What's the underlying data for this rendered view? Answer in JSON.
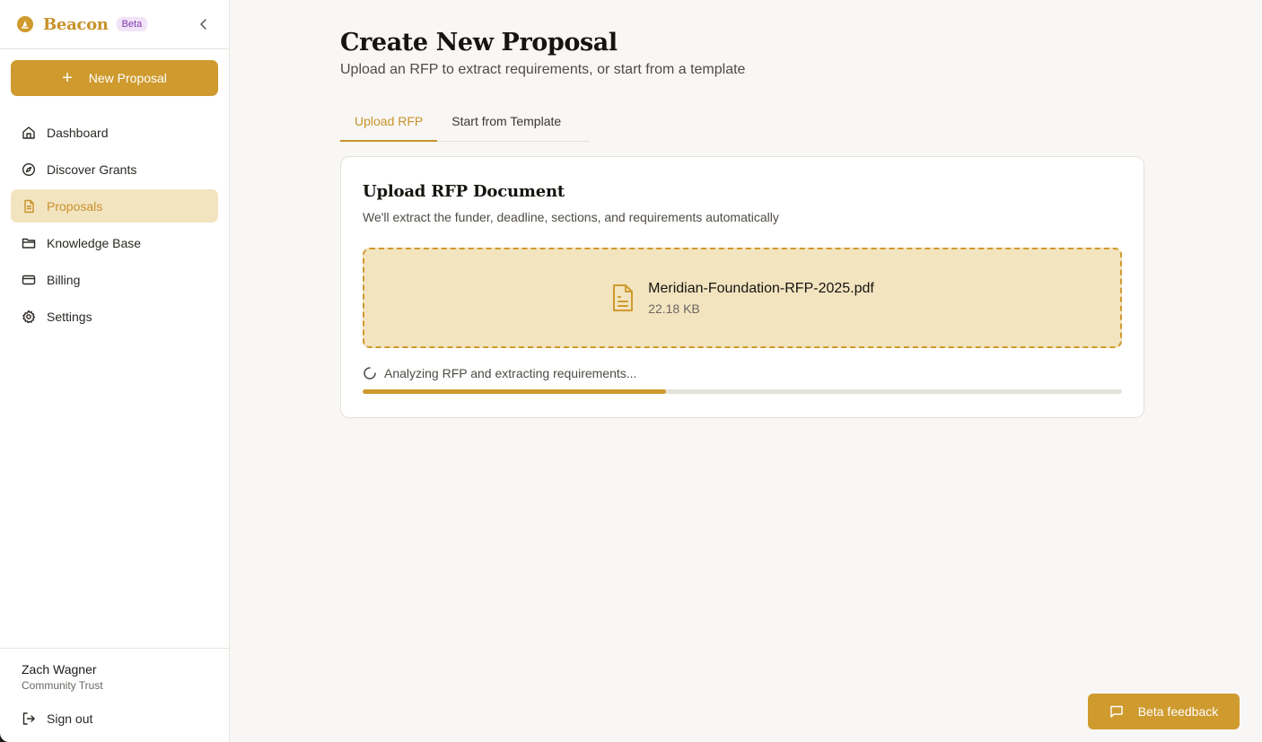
{
  "brand": {
    "name": "Beacon",
    "badge": "Beta",
    "logo_icon": "beacon-logo-icon"
  },
  "sidebar": {
    "new_button_label": "New Proposal",
    "items": [
      {
        "label": "Dashboard",
        "icon": "home-icon"
      },
      {
        "label": "Discover Grants",
        "icon": "compass-icon"
      },
      {
        "label": "Proposals",
        "icon": "file-text-icon",
        "active": true
      },
      {
        "label": "Knowledge Base",
        "icon": "folder-icon"
      },
      {
        "label": "Billing",
        "icon": "credit-card-icon"
      },
      {
        "label": "Settings",
        "icon": "gear-icon"
      }
    ],
    "user": {
      "name": "Zach Wagner",
      "org": "Community Trust"
    },
    "signout_label": "Sign out"
  },
  "page": {
    "title": "Create New Proposal",
    "subtitle": "Upload an RFP to extract requirements, or start from a template"
  },
  "tabs": [
    {
      "label": "Upload RFP",
      "active": true
    },
    {
      "label": "Start from Template",
      "active": false
    }
  ],
  "upload_card": {
    "title": "Upload RFP Document",
    "description": "We'll extract the funder, deadline, sections, and requirements automatically",
    "file": {
      "name": "Meridian-Foundation-RFP-2025.pdf",
      "size": "22.18 KB"
    },
    "status_text": "Analyzing RFP and extracting requirements...",
    "progress": 0.4
  },
  "feedback_button": {
    "label": "Beta feedback"
  },
  "colors": {
    "accent": "#cf9a2e",
    "accent_light": "#f3e4c0",
    "badge": "#7e3aa8"
  }
}
